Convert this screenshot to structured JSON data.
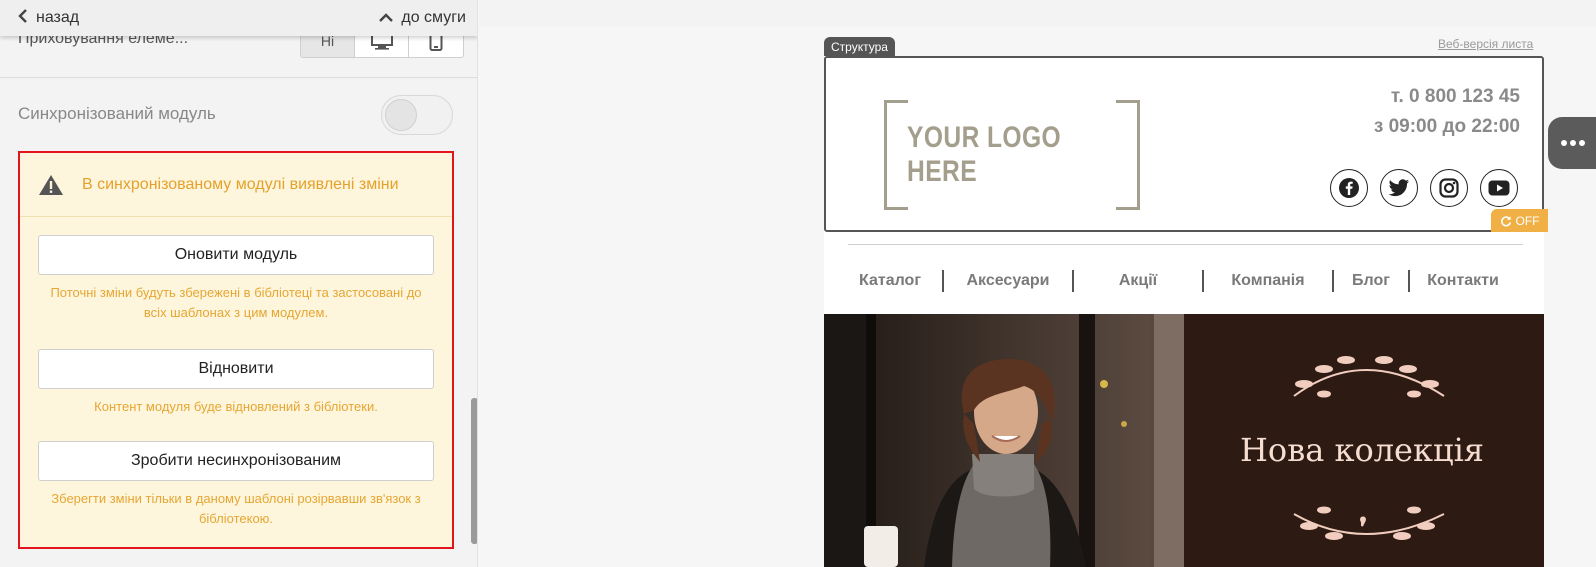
{
  "panel": {
    "back_label": "назад",
    "strip_label": "до смуги",
    "hide_elements_label": "Приховування елеме...",
    "hide_options": [
      "Ні",
      "desktop-icon",
      "mobile-icon"
    ],
    "sync_module_label": "Синхронізований модуль",
    "sync_module_on": false
  },
  "warning": {
    "title": "В синхронізованому модулі виявлені зміни",
    "update_button": "Оновити модуль",
    "update_hint": "Поточні зміни будуть збережені в бібліотеці та застосовані до всіх шаблонах з цим модулем.",
    "restore_button": "Відновити",
    "restore_hint": "Контент модуля буде відновлений з бібліотеки.",
    "unsync_button": "Зробити несинхронізованим",
    "unsync_hint": "Зберегти зміни тільки в даному шаблоні розірвавши зв'язок з бібліотекою."
  },
  "preview": {
    "structure_tag": "Структура",
    "web_version_link": "Веб-версія листа",
    "logo_text": "YOUR LOGO HERE",
    "phone": "т. 0 800 123 45",
    "hours": "з 09:00 до 22:00",
    "social_icons": [
      "facebook-icon",
      "twitter-icon",
      "instagram-icon",
      "youtube-icon"
    ],
    "off_badge": "OFF",
    "menu": [
      "Каталог",
      "Аксесуари",
      "Акції",
      "Компанія",
      "Блог",
      "Контакти"
    ],
    "hero_title": "Нова колекція"
  },
  "colors": {
    "warning_border": "#e3151c",
    "warning_bg": "#fdf6dc",
    "warning_text": "#e5a12b",
    "off_badge": "#f0b046",
    "logo": "#a49e8d",
    "hero_bg": "#2c1a14",
    "hero_text": "#f6ddd2"
  }
}
